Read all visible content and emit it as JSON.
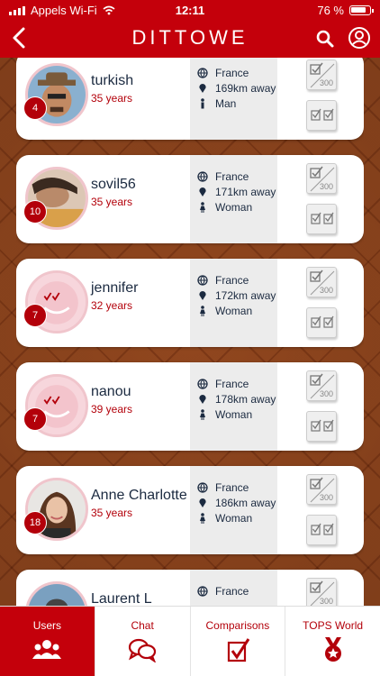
{
  "status": {
    "carrier": "Appels Wi-Fi",
    "time": "12:11",
    "battery": "76 %"
  },
  "header": {
    "brand": "DITTOWE"
  },
  "users": [
    {
      "name": "turkish",
      "age": "35 years",
      "country": "France",
      "distance": "169km away",
      "gender": "Man",
      "badge": "4",
      "comparisons": "300"
    },
    {
      "name": "sovil56",
      "age": "35 years",
      "country": "France",
      "distance": "171km away",
      "gender": "Woman",
      "badge": "10",
      "comparisons": "300"
    },
    {
      "name": "jennifer",
      "age": "32 years",
      "country": "France",
      "distance": "172km away",
      "gender": "Woman",
      "badge": "7",
      "comparisons": "300"
    },
    {
      "name": "nanou",
      "age": "39 years",
      "country": "France",
      "distance": "178km away",
      "gender": "Woman",
      "badge": "7",
      "comparisons": "300"
    },
    {
      "name": "Anne Charlotte",
      "age": "35 years",
      "country": "France",
      "distance": "186km away",
      "gender": "Woman",
      "badge": "18",
      "comparisons": "300"
    },
    {
      "name": "Laurent L",
      "age": "",
      "country": "France",
      "distance": "",
      "gender": "",
      "badge": "",
      "comparisons": "300"
    }
  ],
  "tabs": [
    {
      "label": "Users",
      "icon": "users-icon",
      "active": true
    },
    {
      "label": "Chat",
      "icon": "chat-icon",
      "active": false
    },
    {
      "label": "Comparisons",
      "icon": "comparison-check-icon",
      "active": false
    },
    {
      "label": "TOPS World",
      "icon": "medal-icon",
      "active": false
    }
  ],
  "colors": {
    "brand_red": "#c4000b",
    "text_dark": "#1b2a40",
    "info_bg": "#ececec"
  }
}
